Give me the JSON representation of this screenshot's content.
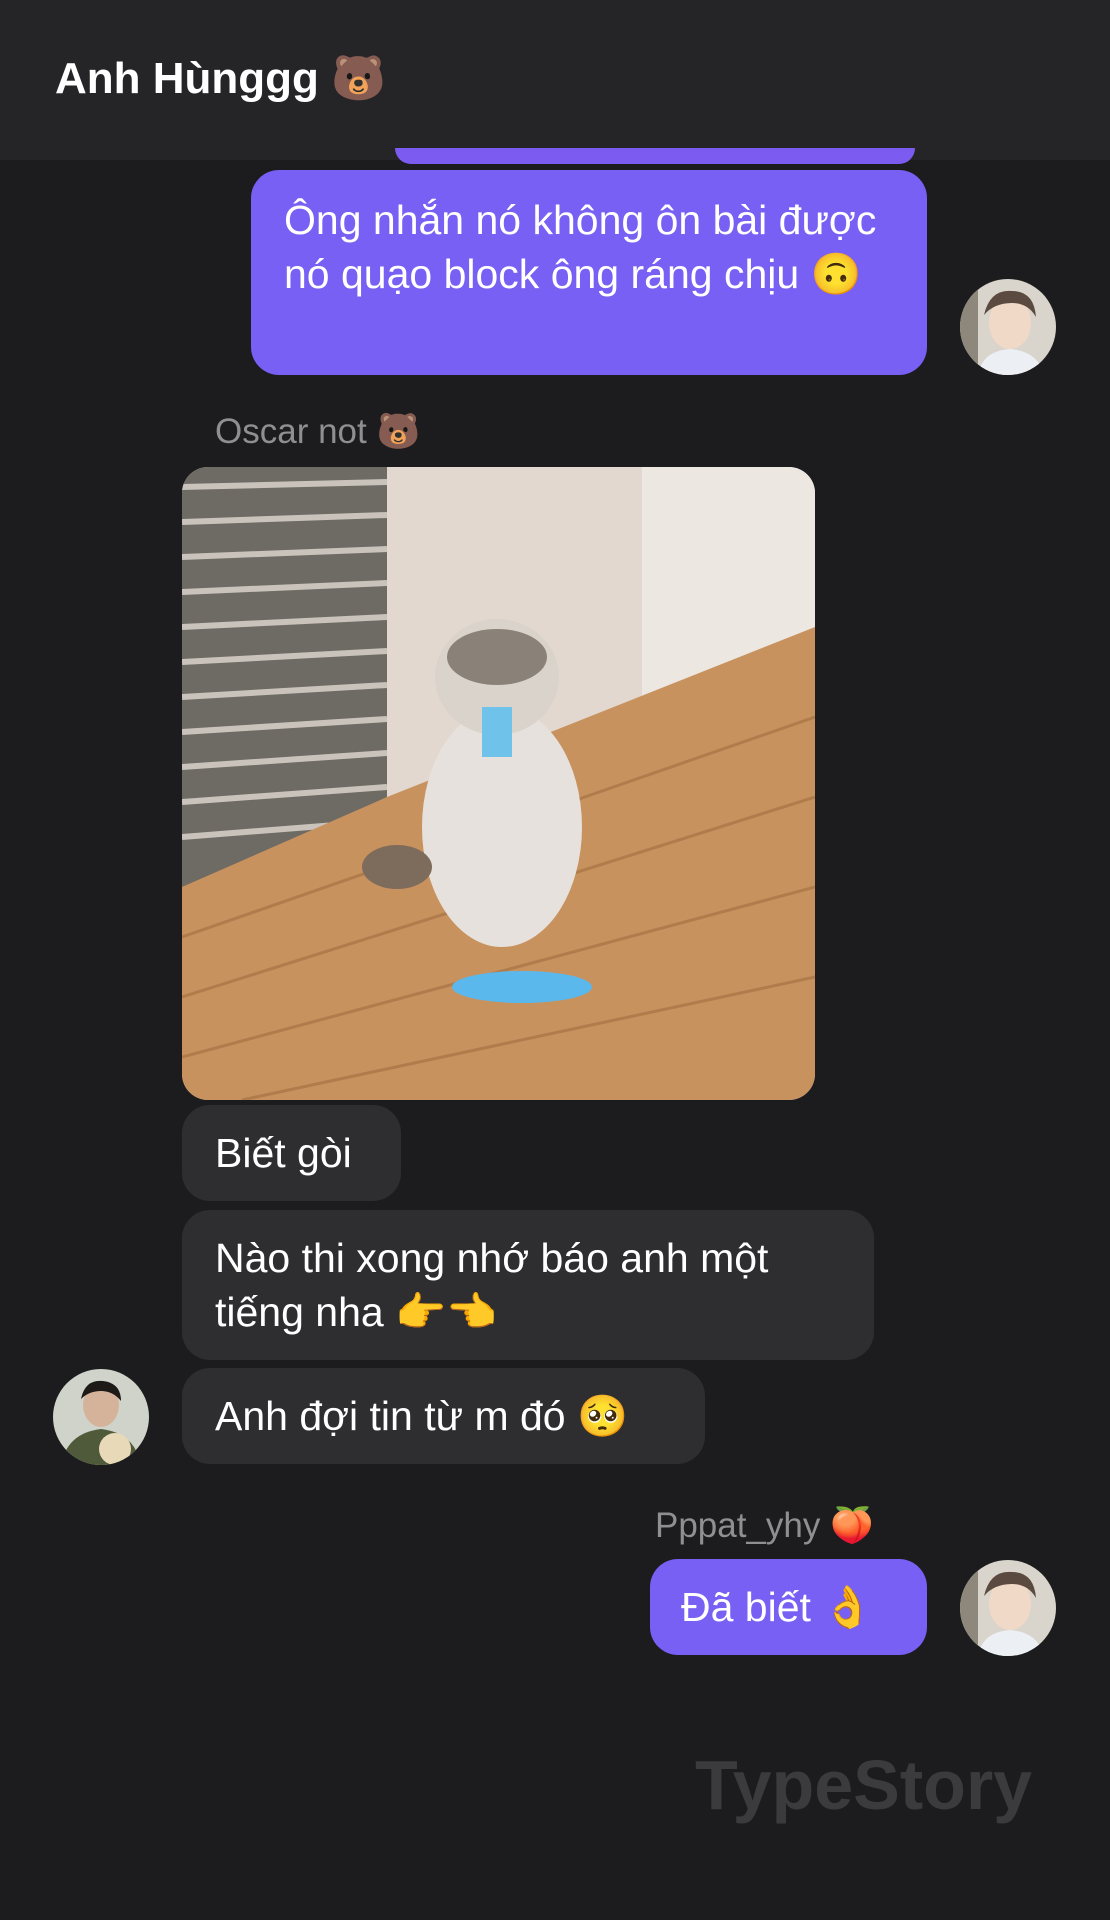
{
  "header": {
    "title": "Anh Hùnggg 🐻"
  },
  "messages": {
    "m1": {
      "text": "Ông nhắn nó không ôn bài được nó quạo block ông ráng chịu 🙃"
    },
    "sender_oscar": "Oscar not 🐻",
    "m2": {
      "text": "Biết gòi"
    },
    "m3": {
      "text": "Nào thi xong nhớ báo anh một tiếng nha 👉👈"
    },
    "m4": {
      "text": "Anh đợi tin từ m đó 🥺"
    },
    "sender_pppat": "Pppat_yhy 🍑",
    "m5": {
      "text": "Đã biết 👌"
    }
  },
  "watermark": "TypeStory",
  "colors": {
    "background": "#1c1c1e",
    "header": "#252527",
    "my_bubble": "#7760f3",
    "their_bubble": "#2e2e30",
    "sender_text": "#8e8e93"
  }
}
